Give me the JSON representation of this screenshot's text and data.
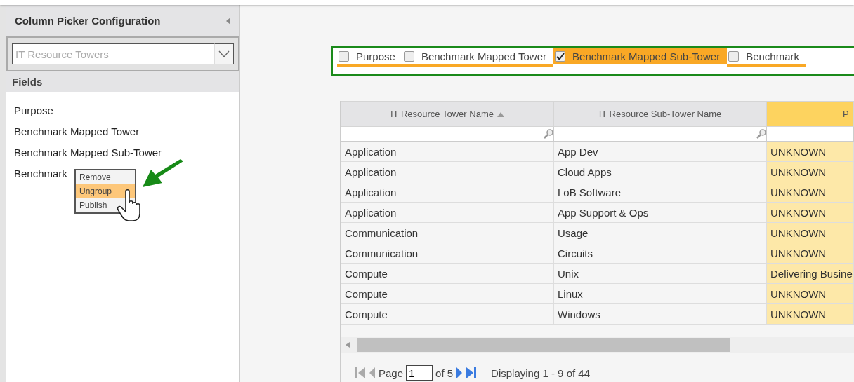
{
  "panel": {
    "title": "Column Picker Configuration",
    "dropdown": {
      "placeholder": "IT Resource Towers"
    },
    "fields_heading": "Fields",
    "fields": [
      "Purpose",
      "Benchmark Mapped Tower",
      "Benchmark Mapped Sub-Tower",
      "Benchmark"
    ],
    "context_menu": [
      {
        "label": "Remove",
        "selected": false
      },
      {
        "label": "Ungroup",
        "selected": true
      },
      {
        "label": "Publish",
        "selected": false
      }
    ]
  },
  "column_bar": [
    {
      "label": "Purpose",
      "checked": false,
      "selected": false
    },
    {
      "label": "Benchmark Mapped Tower",
      "checked": false,
      "selected": false
    },
    {
      "label": "Benchmark Mapped Sub-Tower",
      "checked": true,
      "selected": true
    },
    {
      "label": "Benchmark",
      "checked": false,
      "selected": false
    }
  ],
  "table": {
    "columns": [
      {
        "label": "IT Resource Tower Name",
        "sorted": true,
        "highlighted": false
      },
      {
        "label": "IT Resource Sub-Tower Name",
        "sorted": false,
        "highlighted": false
      },
      {
        "label": "P",
        "sorted": false,
        "highlighted": true
      }
    ],
    "rows": [
      [
        "Application",
        "App Dev",
        "UNKNOWN"
      ],
      [
        "Application",
        "Cloud Apps",
        "UNKNOWN"
      ],
      [
        "Application",
        "LoB Software",
        "UNKNOWN"
      ],
      [
        "Application",
        "App Support & Ops",
        "UNKNOWN"
      ],
      [
        "Communication",
        "Usage",
        "UNKNOWN"
      ],
      [
        "Communication",
        "Circuits",
        "UNKNOWN"
      ],
      [
        "Compute",
        "Unix",
        "Delivering Busine"
      ],
      [
        "Compute",
        "Linux",
        "UNKNOWN"
      ],
      [
        "Compute",
        "Windows",
        "UNKNOWN"
      ]
    ]
  },
  "pager": {
    "page_label": "Page",
    "page": "1",
    "of": "of 5",
    "display": "Displaying 1 - 9 of 44"
  }
}
